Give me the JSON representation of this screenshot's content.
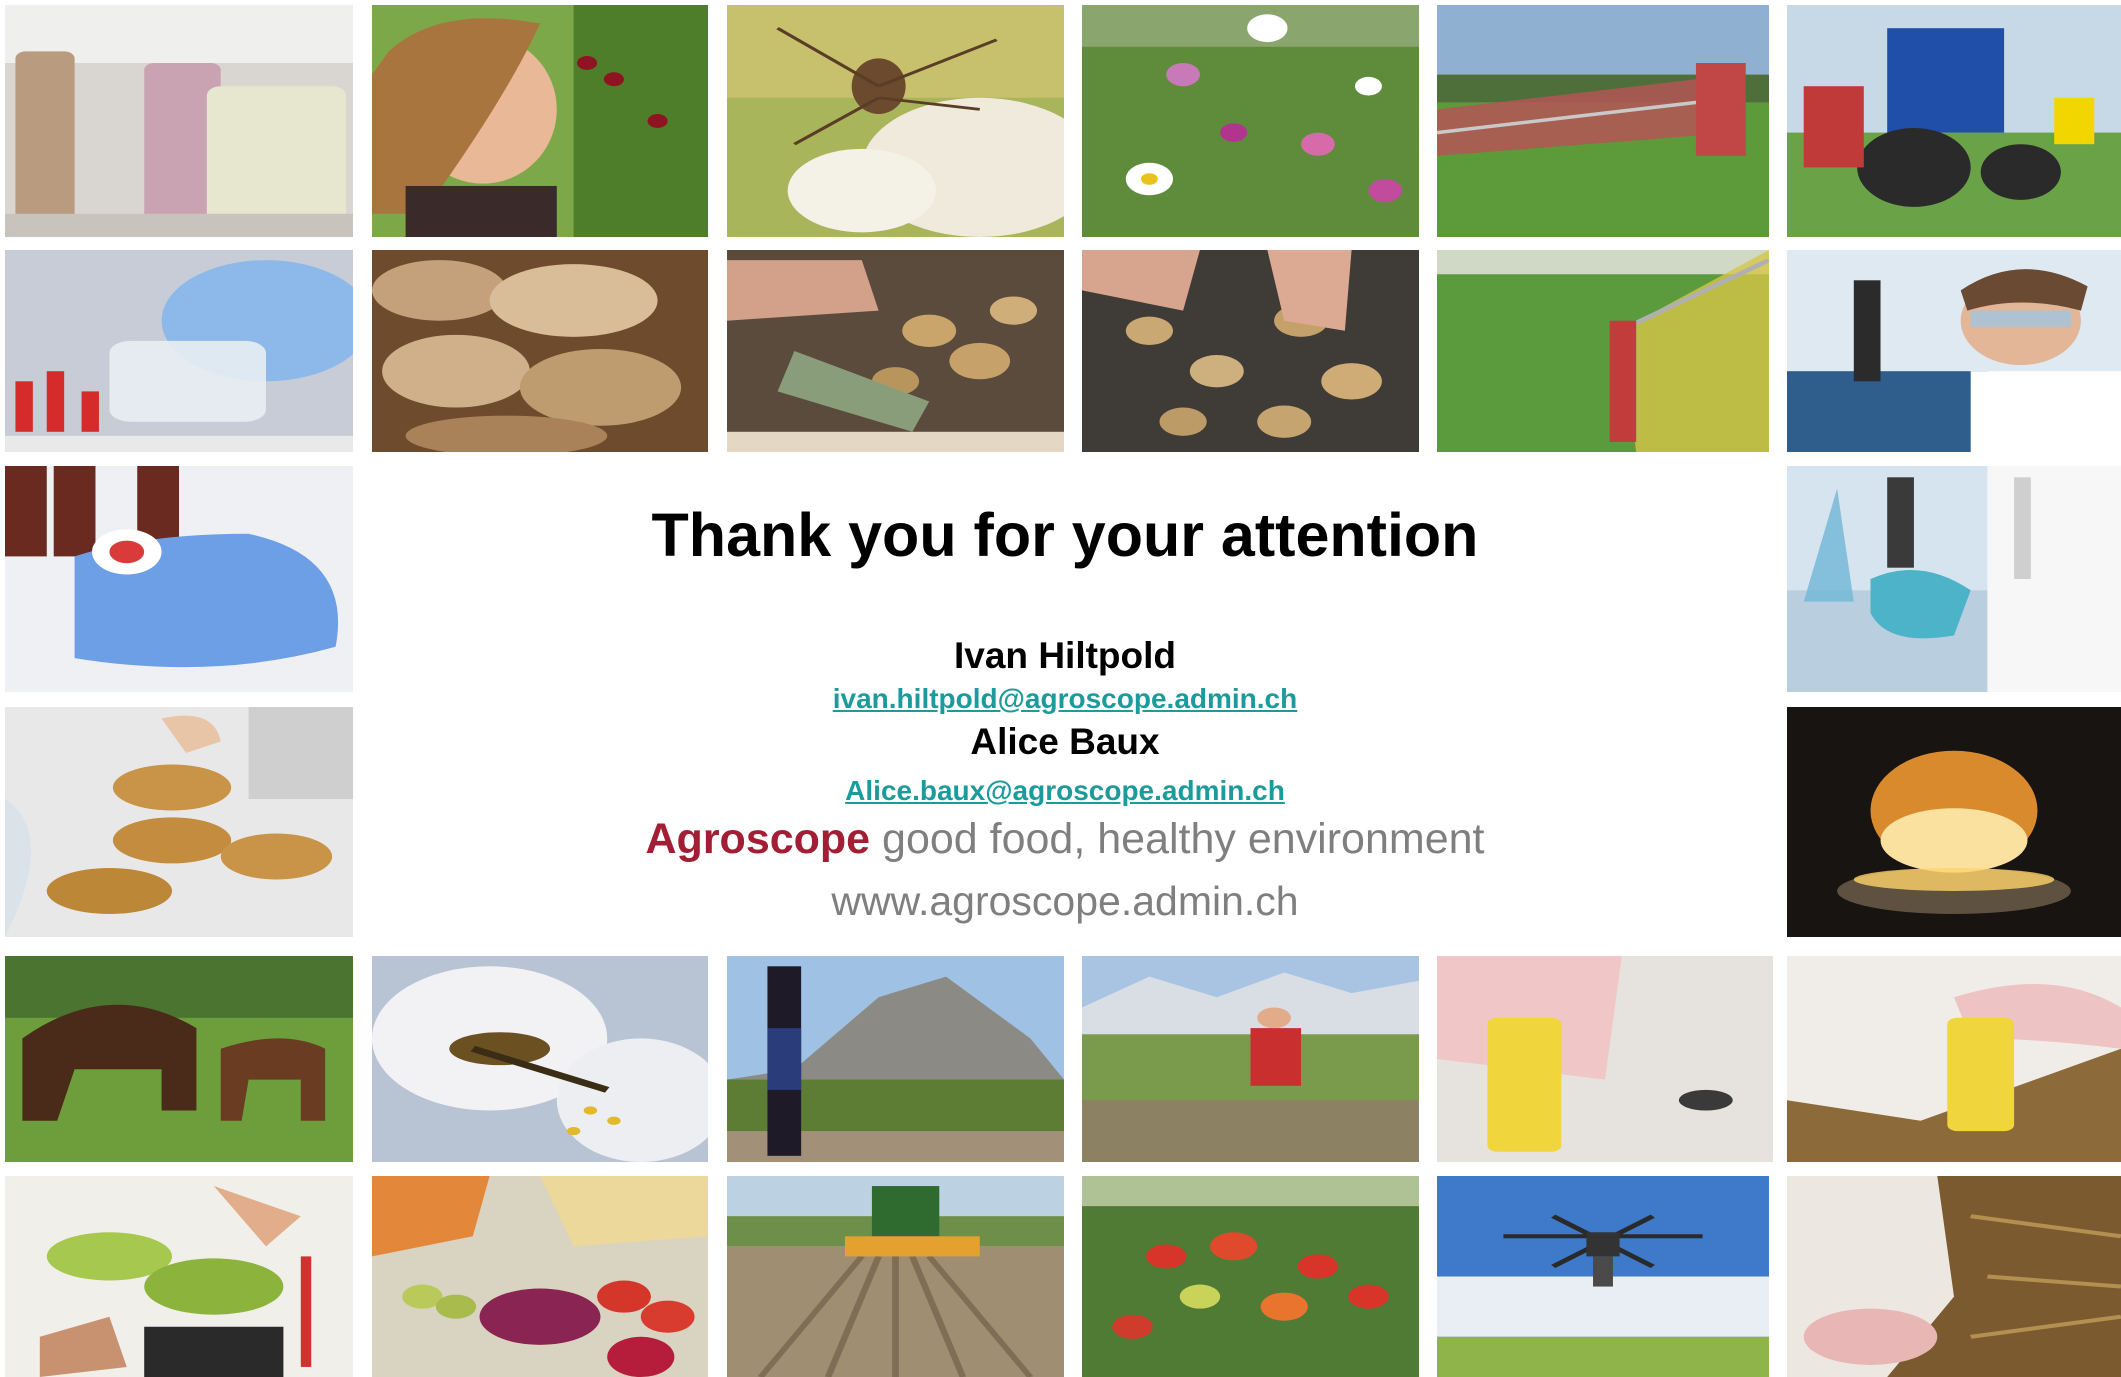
{
  "slide": {
    "title": "Thank you for your attention",
    "contacts": [
      {
        "name": "Ivan Hiltpold",
        "email": "ivan.hiltpold@agroscope.admin.ch"
      },
      {
        "name": "Alice Baux",
        "email": "Alice.baux@agroscope.admin.ch"
      }
    ],
    "brand": "Agroscope",
    "tagline": " good food, healthy environment",
    "website": "www.agroscope.admin.ch"
  },
  "colors": {
    "brand": "#a21e34",
    "link": "#1b9b9b",
    "tagline": "#7f7f7f"
  },
  "photos": [
    {
      "subject": "dairy-jars"
    },
    {
      "subject": "woman-picking-cherries"
    },
    {
      "subject": "insect-on-flower"
    },
    {
      "subject": "meadow-flowers"
    },
    {
      "subject": "slurry-spreader"
    },
    {
      "subject": "blue-tractor"
    },
    {
      "subject": "pouring-liquid-glove"
    },
    {
      "subject": "bread-loaves"
    },
    {
      "subject": "potato-sorting-hands"
    },
    {
      "subject": "potatoes-on-grid"
    },
    {
      "subject": "field-sprayer"
    },
    {
      "subject": "scientist-microscope"
    },
    {
      "subject": "lab-bottle-gloved-hand"
    },
    {
      "subject": "lab-pipette-flask"
    },
    {
      "subject": "petri-dishes"
    },
    {
      "subject": "onion-on-lamp"
    },
    {
      "subject": "horses-grazing"
    },
    {
      "subject": "bee-on-blossom"
    },
    {
      "subject": "wine-bottle-vineyard"
    },
    {
      "subject": "researcher-in-field"
    },
    {
      "subject": "calf-ear-tag"
    },
    {
      "subject": "white-calf-ear-tag"
    },
    {
      "subject": "seedling-plant-hands"
    },
    {
      "subject": "vegetables-and-cheese"
    },
    {
      "subject": "tractor-tilling-field"
    },
    {
      "subject": "greenhouse-tomatoes"
    },
    {
      "subject": "drone-over-field"
    },
    {
      "subject": "calf-nose-straw"
    }
  ]
}
